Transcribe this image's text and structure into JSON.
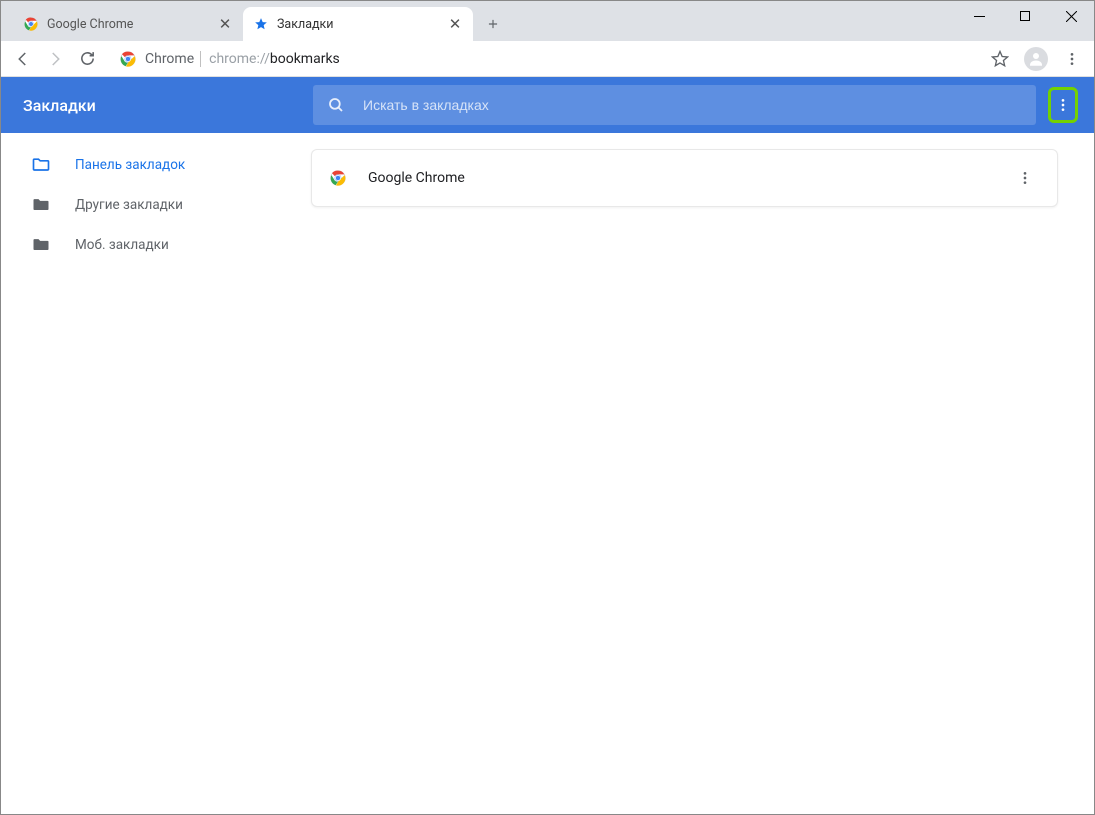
{
  "window": {
    "tabs": [
      {
        "title": "Google Chrome",
        "icon": "chrome-icon",
        "active": false
      },
      {
        "title": "Закладки",
        "icon": "star-icon",
        "active": true
      }
    ]
  },
  "omnibox": {
    "origin": "Chrome",
    "scheme": "chrome://",
    "path": "bookmarks"
  },
  "app": {
    "title": "Закладки",
    "search_placeholder": "Искать в закладках"
  },
  "sidebar": {
    "items": [
      {
        "label": "Панель закладок",
        "active": true
      },
      {
        "label": "Другие закладки",
        "active": false
      },
      {
        "label": "Моб. закладки",
        "active": false
      }
    ]
  },
  "bookmarks": [
    {
      "title": "Google Chrome",
      "icon": "chrome-icon"
    }
  ]
}
